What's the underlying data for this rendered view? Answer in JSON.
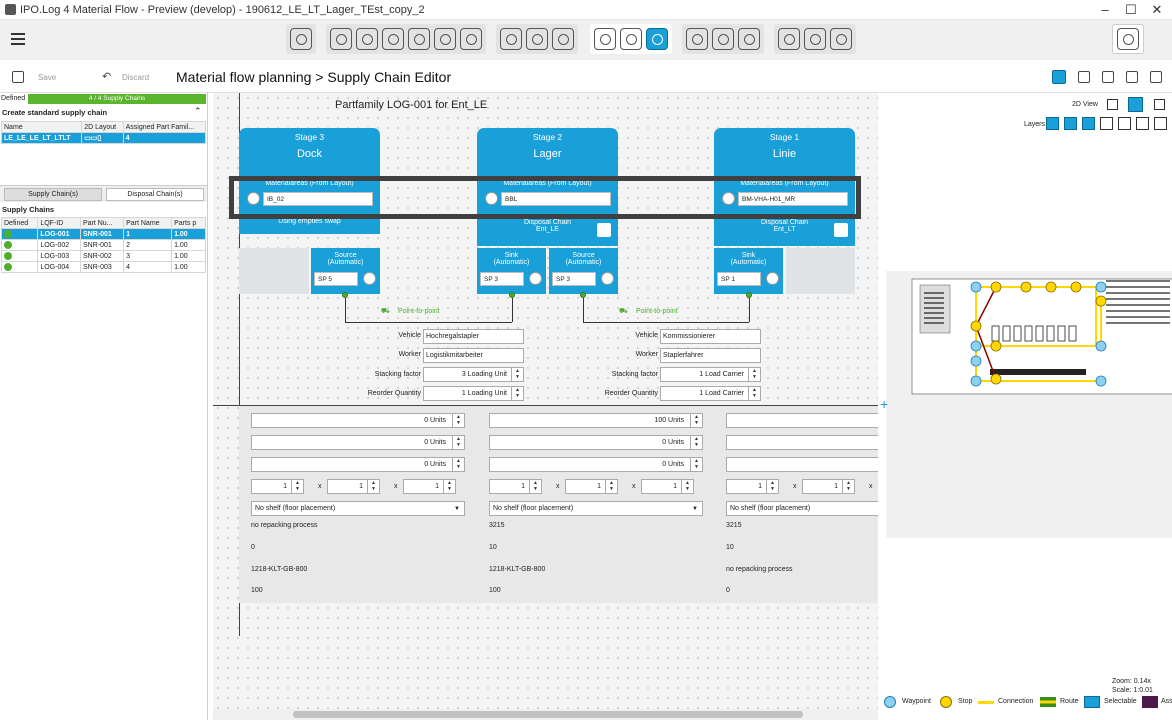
{
  "window": {
    "title": "IPO.Log 4 Material Flow - Preview (develop) - 190612_LE_LT_Lager_TEst_copy_2",
    "minimize": "–",
    "maximize": "☐",
    "close": "✕"
  },
  "commands": {
    "save": "Save",
    "discard": "Discard"
  },
  "breadcrumb": {
    "root": "Material flow planning",
    "sep": ">",
    "current": "Supply Chain Editor"
  },
  "left_panel": {
    "defined_label": "Defined",
    "defined_bar": "4 / 4 Supply Chains",
    "create_title": "Create standard supply chain",
    "chain_table": {
      "headers": [
        "Name",
        "2D Layout",
        "Assigned Part Famil..."
      ],
      "row": {
        "name": "LE_LE_LE_LT_LTLT",
        "count": "4"
      }
    },
    "tabs": [
      "Supply Chain(s)",
      "Disposal Chain(s)"
    ],
    "chains_title": "Supply Chains",
    "columns": [
      "Defined",
      "LQF-ID",
      "Part Nu...",
      "Part Name",
      "Parts p"
    ],
    "rows": [
      {
        "id": "LOG-001",
        "part": "SNR-001",
        "name": "1",
        "pp": "1.00"
      },
      {
        "id": "LOG-002",
        "part": "SNR-001",
        "name": "2",
        "pp": "1.00"
      },
      {
        "id": "LOG-003",
        "part": "SNR-002",
        "name": "3",
        "pp": "1.00"
      },
      {
        "id": "LOG-004",
        "part": "SNR-003",
        "name": "4",
        "pp": "1.00"
      }
    ]
  },
  "editor": {
    "title": "Partfamily LOG-001 for Ent_LE",
    "mat_label": "Materialareas (From Layout)",
    "stages": [
      {
        "stage": "Stage 3",
        "name": "Dock",
        "area": "IB_02"
      },
      {
        "stage": "Stage 2",
        "name": "Lager",
        "area": "BBL"
      },
      {
        "stage": "Stage 1",
        "name": "Linie",
        "area": "BM-VHA-H01_MR"
      }
    ],
    "dock_sub": "Using empties swap",
    "disposal": "Disposal Chain",
    "disposal_ent": [
      "Ent_LE",
      "Ent_LT"
    ],
    "source": "Source",
    "sink": "Sink",
    "auto": "(Automatic)",
    "sp": [
      "SP 5",
      "SP 3",
      "SP 3",
      "SP 1"
    ],
    "p2p": "Point-to-point",
    "transport": [
      {
        "vehicle": "Hochregalstapler",
        "worker": "Logistikmitarbeiter",
        "stacking": "3 Loading Unit",
        "reorder": "1 Loading Unit"
      },
      {
        "vehicle": "Kommissionierer",
        "worker": "Staplerfahrer",
        "stacking": "1 Load Carrier",
        "reorder": "1 Load Carrier"
      }
    ],
    "labels": {
      "vehicle": "Vehicle",
      "worker": "Worker",
      "stacking": "Stacking factor",
      "reorder": "Reorder Quantity"
    },
    "columns": [
      {
        "units": [
          "0 Units",
          "0 Units",
          "0 Units"
        ],
        "dims": [
          "1",
          "1",
          "1"
        ],
        "shelf": "No shelf (floor placement)",
        "info": [
          "no repacking process",
          "0",
          "1218-KLT-GB-800",
          "100"
        ]
      },
      {
        "units": [
          "100 Units",
          "0 Units",
          "0 Units"
        ],
        "dims": [
          "1",
          "1",
          "1"
        ],
        "shelf": "No shelf (floor placement)",
        "info": [
          "3215",
          "10",
          "1218-KLT-GB-800",
          "100"
        ]
      },
      {
        "units": [
          "",
          "",
          ""
        ],
        "dims": [
          "1",
          "1",
          "1"
        ],
        "shelf": "No shelf (floor placement)",
        "info": [
          "3215",
          "10",
          "no repacking process",
          "0"
        ]
      }
    ],
    "x": "x"
  },
  "right_panel": {
    "view": "2D View",
    "layers": "Layers",
    "zoom": "Zoom: 0.14x",
    "scale": "Scale: 1:0.01",
    "legend": [
      "Waypoint",
      "Stop",
      "Connection",
      "Route",
      "Selectable",
      "Ass"
    ]
  },
  "colors": {
    "accent": "#1aa0d8",
    "ok": "#4cae2c",
    "route": "#ffd800"
  }
}
